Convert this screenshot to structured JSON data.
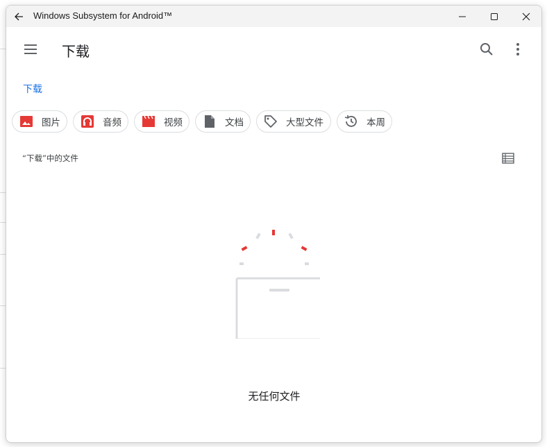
{
  "window": {
    "title": "Windows Subsystem for Android™"
  },
  "app_bar": {
    "title": "下载"
  },
  "breadcrumb": {
    "root": "下载"
  },
  "chips": [
    {
      "label": "图片",
      "icon": "image-icon"
    },
    {
      "label": "音频",
      "icon": "headphones-icon"
    },
    {
      "label": "视频",
      "icon": "clapperboard-icon"
    },
    {
      "label": "文档",
      "icon": "document-icon"
    },
    {
      "label": "大型文件",
      "icon": "tag-icon"
    },
    {
      "label": "本周",
      "icon": "history-icon"
    }
  ],
  "section": {
    "label": "“下载”中的文件"
  },
  "empty_state": {
    "message": "无任何文件"
  },
  "colors": {
    "accent": "#1a73e8",
    "chip_icon_red": "#e53935",
    "chip_icon_gray": "#5f6368",
    "illustration_gray": "#dadce0"
  }
}
